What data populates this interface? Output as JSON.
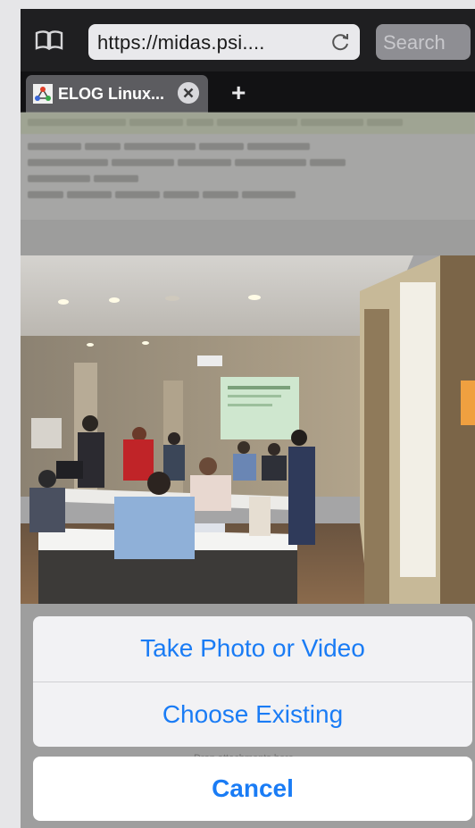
{
  "browser": {
    "url": "https://midas.psi....",
    "search_placeholder": "Search",
    "tab_title": "ELOG Linux...",
    "new_tab_symbol": "+"
  },
  "page": {
    "attachments_hint": "Drop attachments here..."
  },
  "action_sheet": {
    "take_photo_label": "Take Photo or Video",
    "choose_existing_label": "Choose Existing",
    "cancel_label": "Cancel"
  },
  "colors": {
    "accent": "#1a7cf5",
    "chrome_dark": "#1f1f21"
  },
  "icons": {
    "bookmarks": "book-icon",
    "reload": "reload-icon",
    "tab_close": "close-icon",
    "favicon": "elog-favicon"
  }
}
